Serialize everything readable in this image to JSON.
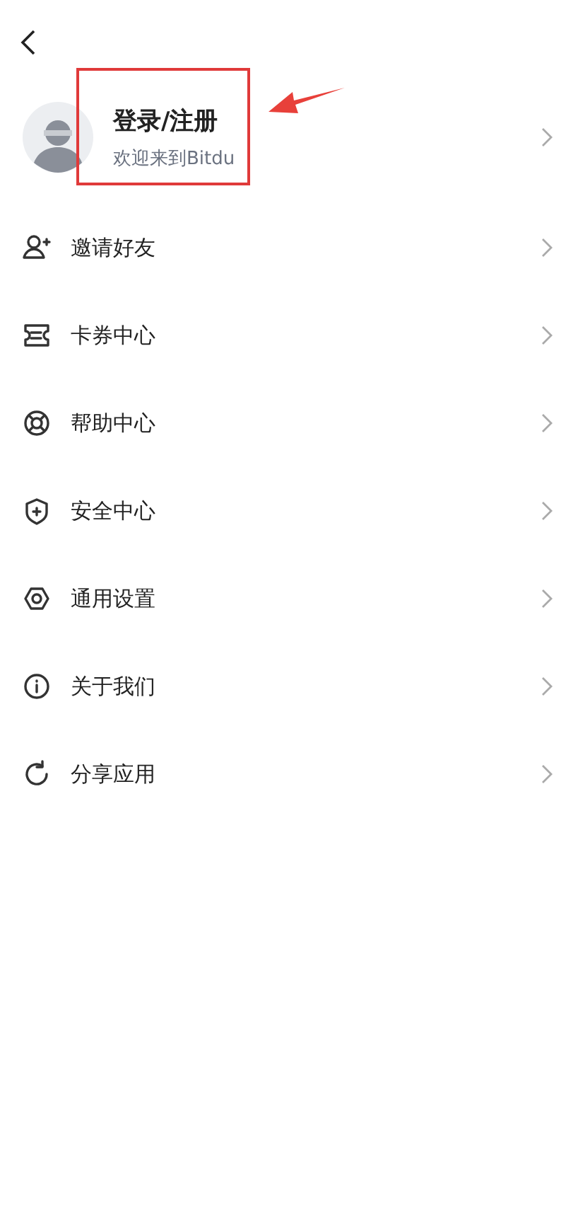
{
  "profile": {
    "title": "登录/注册",
    "subtitle": "欢迎来到Bitdu"
  },
  "menu": [
    {
      "label": "邀请好友"
    },
    {
      "label": "卡券中心"
    },
    {
      "label": "帮助中心"
    },
    {
      "label": "安全中心"
    },
    {
      "label": "通用设置"
    },
    {
      "label": "关于我们"
    },
    {
      "label": "分享应用"
    }
  ]
}
